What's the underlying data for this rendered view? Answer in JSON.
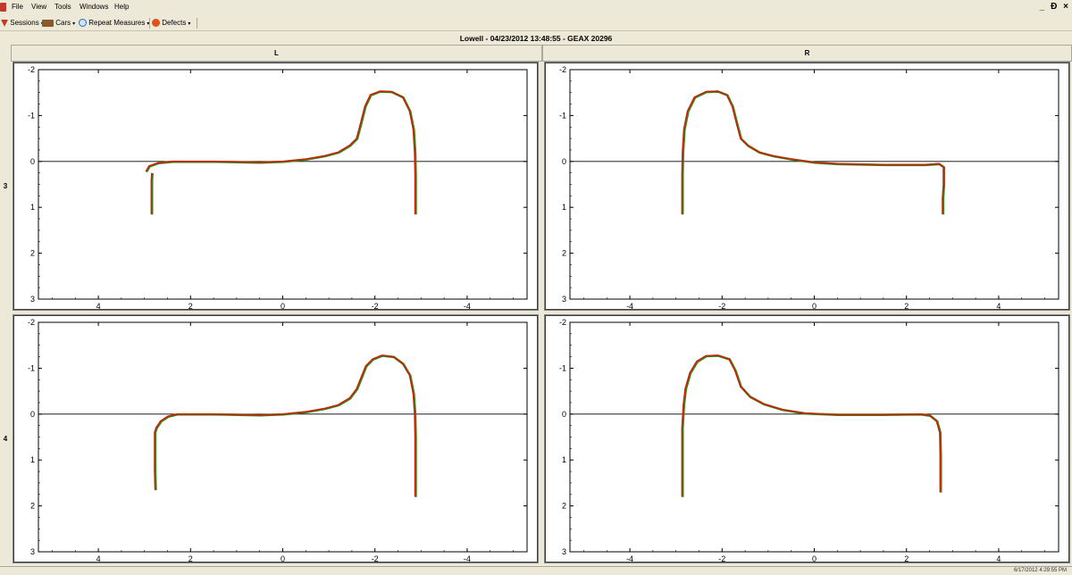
{
  "menubar": {
    "items": [
      "File",
      "View",
      "Tools",
      "Windows",
      "Help"
    ],
    "window_controls": [
      "_",
      "Ɖ",
      "×"
    ]
  },
  "toolbar": {
    "sessions": "Sessions",
    "cars": "Cars",
    "repeat_measures": "Repeat Measures",
    "defects": "Defects",
    "dropdown_glyph": "▾"
  },
  "header": {
    "title": "Lowell - 04/23/2012 13:48:55 - GEAX 20296"
  },
  "columns": [
    "L",
    "R"
  ],
  "rows": [
    "3",
    "4"
  ],
  "status": {
    "time": "6/17/2012 4:29:55 PM"
  },
  "colors": {
    "series_primary": "#cc2200",
    "series_secondary": "#2e8b22",
    "axis": "#000000"
  },
  "chart_data": [
    {
      "type": "line",
      "panel": "row3-L",
      "xlim": [
        5.3,
        -5.3
      ],
      "ylim": [
        -2,
        3
      ],
      "x_reversed": true,
      "y_reversed": true,
      "xticks": [
        4,
        2,
        0,
        -2,
        -4
      ],
      "yticks": [
        -2,
        -1,
        0,
        1,
        2,
        3
      ],
      "series": [
        {
          "values": [
            [
              2.85,
              1.15
            ],
            [
              2.85,
              0.8
            ],
            [
              2.85,
              0.4
            ],
            [
              2.84,
              0.25
            ]
          ]
        },
        {
          "values": [
            [
              2.97,
              0.22
            ],
            [
              2.9,
              0.1
            ],
            [
              2.7,
              0.03
            ],
            [
              2.4,
              0.0
            ],
            [
              1.5,
              0.0
            ],
            [
              0.5,
              0.02
            ],
            [
              0,
              0.0
            ],
            [
              -0.5,
              -0.05
            ],
            [
              -0.9,
              -0.12
            ],
            [
              -1.2,
              -0.2
            ],
            [
              -1.45,
              -0.35
            ],
            [
              -1.6,
              -0.5
            ],
            [
              -1.68,
              -0.8
            ],
            [
              -1.78,
              -1.2
            ],
            [
              -1.9,
              -1.45
            ],
            [
              -2.1,
              -1.53
            ],
            [
              -2.35,
              -1.52
            ],
            [
              -2.6,
              -1.4
            ],
            [
              -2.75,
              -1.1
            ],
            [
              -2.83,
              -0.7
            ],
            [
              -2.86,
              -0.2
            ],
            [
              -2.87,
              0.3
            ],
            [
              -2.87,
              0.8
            ],
            [
              -2.87,
              1.15
            ]
          ]
        }
      ]
    },
    {
      "type": "line",
      "panel": "row3-R",
      "xlim": [
        -5.3,
        5.3
      ],
      "ylim": [
        -2,
        3
      ],
      "y_reversed": true,
      "xticks": [
        -4,
        -2,
        0,
        2,
        4
      ],
      "yticks": [
        -2,
        -1,
        0,
        1,
        2,
        3
      ],
      "series": [
        {
          "values": [
            [
              -2.87,
              1.15
            ],
            [
              -2.87,
              0.8
            ],
            [
              -2.87,
              0.3
            ],
            [
              -2.86,
              -0.2
            ],
            [
              -2.83,
              -0.7
            ],
            [
              -2.75,
              -1.1
            ],
            [
              -2.6,
              -1.4
            ],
            [
              -2.35,
              -1.52
            ],
            [
              -2.1,
              -1.53
            ],
            [
              -1.9,
              -1.45
            ],
            [
              -1.78,
              -1.2
            ],
            [
              -1.68,
              -0.8
            ],
            [
              -1.6,
              -0.5
            ],
            [
              -1.45,
              -0.35
            ],
            [
              -1.2,
              -0.2
            ],
            [
              -0.9,
              -0.12
            ],
            [
              -0.5,
              -0.05
            ],
            [
              0,
              0.02
            ],
            [
              0.5,
              0.05
            ],
            [
              1.5,
              0.07
            ],
            [
              2.4,
              0.07
            ],
            [
              2.7,
              0.05
            ],
            [
              2.8,
              0.12
            ],
            [
              2.8,
              0.22
            ],
            [
              2.8,
              0.5
            ],
            [
              2.78,
              0.8
            ],
            [
              2.78,
              1.15
            ]
          ]
        }
      ]
    },
    {
      "type": "line",
      "panel": "row4-L",
      "xlim": [
        5.3,
        -5.3
      ],
      "ylim": [
        -2,
        3
      ],
      "x_reversed": true,
      "y_reversed": true,
      "xticks": [
        4,
        2,
        0,
        -2,
        -4
      ],
      "yticks": [
        -2,
        -1,
        0,
        1,
        2,
        3
      ],
      "series": [
        {
          "values": [
            [
              2.77,
              1.65
            ],
            [
              2.78,
              1.2
            ],
            [
              2.78,
              0.7
            ],
            [
              2.78,
              0.4
            ],
            [
              2.75,
              0.3
            ],
            [
              2.65,
              0.15
            ],
            [
              2.5,
              0.05
            ],
            [
              2.3,
              0.0
            ],
            [
              1.5,
              0.0
            ],
            [
              0.5,
              0.02
            ],
            [
              0,
              0.0
            ],
            [
              -0.5,
              -0.05
            ],
            [
              -0.9,
              -0.12
            ],
            [
              -1.2,
              -0.2
            ],
            [
              -1.45,
              -0.35
            ],
            [
              -1.6,
              -0.55
            ],
            [
              -1.7,
              -0.8
            ],
            [
              -1.8,
              -1.05
            ],
            [
              -1.95,
              -1.2
            ],
            [
              -2.15,
              -1.28
            ],
            [
              -2.4,
              -1.25
            ],
            [
              -2.6,
              -1.1
            ],
            [
              -2.75,
              -0.85
            ],
            [
              -2.83,
              -0.45
            ],
            [
              -2.86,
              0.0
            ],
            [
              -2.87,
              0.5
            ],
            [
              -2.87,
              1.0
            ],
            [
              -2.87,
              1.5
            ],
            [
              -2.87,
              1.8
            ]
          ]
        }
      ]
    },
    {
      "type": "line",
      "panel": "row4-R",
      "xlim": [
        -5.3,
        5.3
      ],
      "ylim": [
        -2,
        3
      ],
      "y_reversed": true,
      "xticks": [
        -4,
        -2,
        0,
        2,
        4
      ],
      "yticks": [
        -2,
        -1,
        0,
        1,
        2,
        3
      ],
      "series": [
        {
          "values": [
            [
              -2.87,
              1.8
            ],
            [
              -2.87,
              1.4
            ],
            [
              -2.87,
              0.9
            ],
            [
              -2.87,
              0.3
            ],
            [
              -2.84,
              -0.2
            ],
            [
              -2.8,
              -0.55
            ],
            [
              -2.7,
              -0.9
            ],
            [
              -2.55,
              -1.15
            ],
            [
              -2.35,
              -1.27
            ],
            [
              -2.1,
              -1.28
            ],
            [
              -1.85,
              -1.2
            ],
            [
              -1.72,
              -0.95
            ],
            [
              -1.6,
              -0.6
            ],
            [
              -1.4,
              -0.38
            ],
            [
              -1.1,
              -0.22
            ],
            [
              -0.7,
              -0.1
            ],
            [
              -0.2,
              -0.02
            ],
            [
              0.5,
              0.01
            ],
            [
              1.5,
              0.01
            ],
            [
              2.3,
              0.0
            ],
            [
              2.5,
              0.03
            ],
            [
              2.65,
              0.15
            ],
            [
              2.72,
              0.4
            ],
            [
              2.73,
              0.9
            ],
            [
              2.73,
              1.3
            ],
            [
              2.73,
              1.7
            ]
          ]
        }
      ]
    }
  ]
}
